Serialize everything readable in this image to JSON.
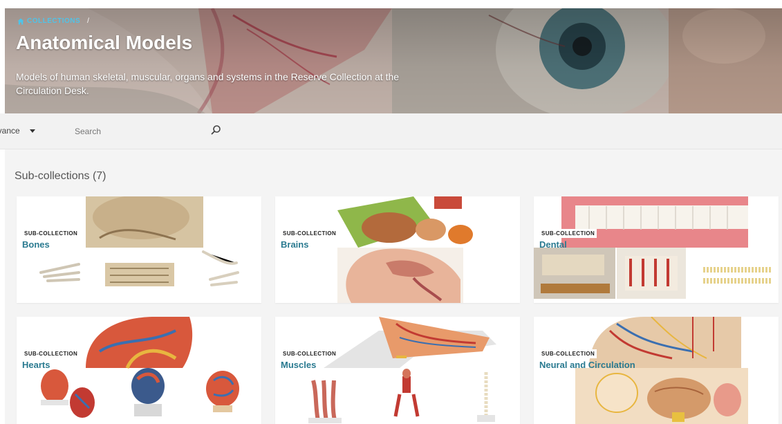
{
  "breadcrumb": {
    "link": "COLLECTIONS",
    "separator": "/"
  },
  "page": {
    "title": "Anatomical Models",
    "description": "Models of human skeletal, muscular, organs and systems in the Reserve Collection at the Circulation Desk."
  },
  "toolbar": {
    "sort_label": "Relevance",
    "search_placeholder": "Search"
  },
  "subcollections": {
    "heading": "Sub-collections (7)",
    "badge": "SUB-COLLECTION",
    "items": [
      {
        "title": "Bones"
      },
      {
        "title": "Brains"
      },
      {
        "title": "Dental"
      },
      {
        "title": "Hearts"
      },
      {
        "title": "Muscles"
      },
      {
        "title": "Neural and Circulation"
      }
    ]
  },
  "colors": {
    "accent": "#4fc3e8",
    "card_title": "#2a7a90"
  }
}
